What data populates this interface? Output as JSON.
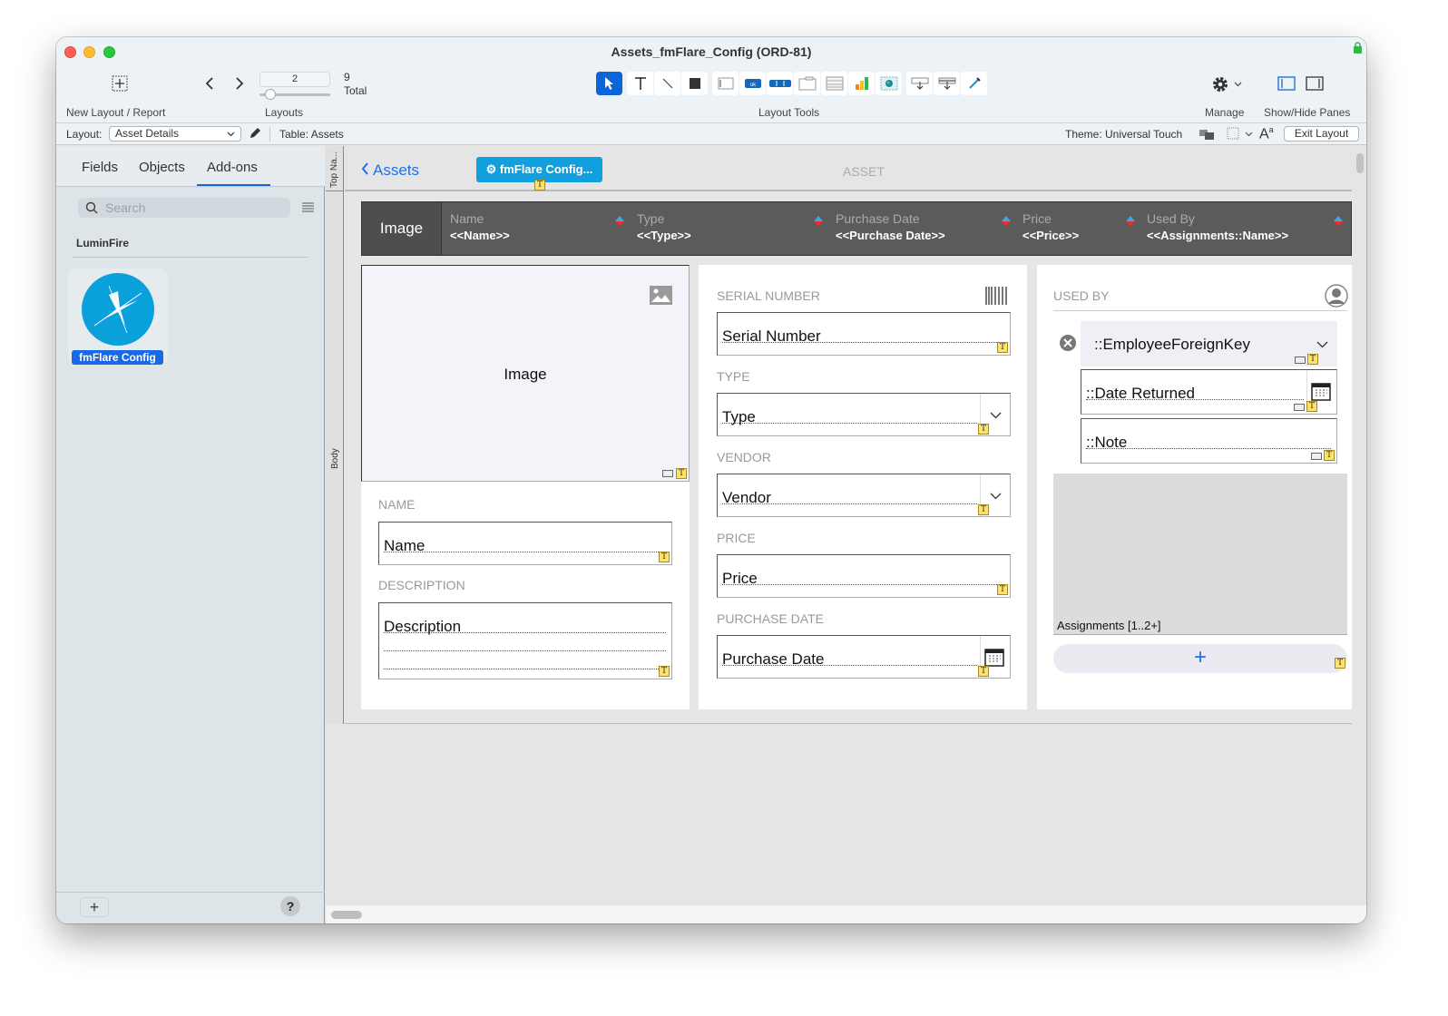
{
  "window": {
    "title": "Assets_fmFlare_Config (ORD-81)"
  },
  "toolbar": {
    "new_layout_label": "New Layout / Report",
    "layouts_label": "Layouts",
    "layout_number": "2",
    "layout_total": "9",
    "total_label": "Total",
    "layout_tools_label": "Layout Tools",
    "manage_label": "Manage",
    "show_hide_label": "Show/Hide Panes",
    "tools": [
      "select-pointer-icon",
      "text-tool-icon",
      "line-tool-icon",
      "shape-tool-icon",
      "field-tool-icon",
      "button-tool-icon",
      "button-bar-tool-icon",
      "tab-control-icon",
      "portal-tool-icon",
      "chart-tool-icon",
      "web-viewer-icon",
      "insert-field-icon",
      "insert-part-icon",
      "format-painter-icon"
    ]
  },
  "infobar": {
    "layout_label": "Layout:",
    "layout_value": "Asset Details",
    "table_label": "Table: Assets",
    "theme_label": "Theme: Universal Touch",
    "exit_label": "Exit Layout"
  },
  "left_pane": {
    "tabs": [
      {
        "label": "Fields"
      },
      {
        "label": "Objects"
      },
      {
        "label": "Add-ons",
        "active": true
      }
    ],
    "search_placeholder": "Search",
    "group_label": "LuminFire",
    "addon": {
      "label": "fmFlare Config"
    },
    "add_label": "+",
    "help_label": "?"
  },
  "parts": {
    "top": "Top Na...",
    "body": "Body"
  },
  "topnav": {
    "back_label": "Assets",
    "flare_button_label": "fmFlare Config...",
    "title": "ASSET"
  },
  "header_bar": {
    "image_label": "Image",
    "columns": [
      {
        "header": "Name",
        "value": "<<Name>>"
      },
      {
        "header": "Type",
        "value": "<<Type>>"
      },
      {
        "header": "Purchase Date",
        "value": "<<Purchase Date>>"
      },
      {
        "header": "Price",
        "value": "<<Price>>"
      },
      {
        "header": "Used By",
        "value": "<<Assignments::Name>>"
      }
    ]
  },
  "card1": {
    "image_label": "Image",
    "name_label": "NAME",
    "name_field": "Name",
    "description_label": "DESCRIPTION",
    "description_field": "Description"
  },
  "card2": {
    "serial_label": "SERIAL NUMBER",
    "serial_field": "Serial Number",
    "type_label": "TYPE",
    "type_field": "Type",
    "vendor_label": "VENDOR",
    "vendor_field": "Vendor",
    "price_label": "PRICE",
    "price_field": "Price",
    "purchase_date_label": "PURCHASE DATE",
    "purchase_date_field": "Purchase Date"
  },
  "card3": {
    "used_by_label": "USED BY",
    "employee_field": "::EmployeeForeignKey",
    "date_returned_field": "::Date Returned",
    "note_field": "::Note",
    "portal_label": "Assignments [1..2+]",
    "add_button": "+"
  },
  "colors": {
    "accent": "#1a64d8",
    "flare": "#129fde",
    "header_bar": "#5b5b5b"
  }
}
